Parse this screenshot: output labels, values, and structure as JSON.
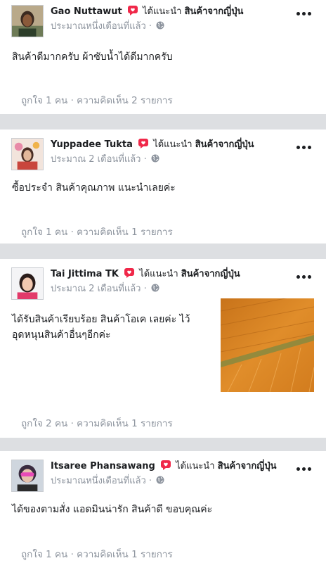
{
  "posts": [
    {
      "name": "Gao Nuttawut",
      "recommends": "ได้แนะนำ",
      "page": "สินค้าจากญี่ปุ่น",
      "time": "ประมาณหนึ่งเดือนที่แล้ว ·",
      "body": "สินค้าดีมากครับ ผ้าซับน้ำได้ดีมากครับ",
      "likes": "ถูกใจ 1 คน",
      "comments": "ความคิดเห็น 2 รายการ"
    },
    {
      "name": "Yuppadee Tukta",
      "recommends": "ได้แนะนำ",
      "page": "สินค้าจากญี่ปุ่น",
      "time": "ประมาณ 2 เดือนที่แล้ว ·",
      "body": "ซื้อประจำ สินค้าคุณภาพ แนะนำเลยค่ะ",
      "likes": "ถูกใจ 1 คน",
      "comments": "ความคิดเห็น 1 รายการ"
    },
    {
      "name": "Tai Jittima TK",
      "recommends": "ได้แนะนำ",
      "page": "สินค้าจากญี่ปุ่น",
      "time": "ประมาณ 2 เดือนที่แล้ว ·",
      "body_line1": "ได้รับสินค้าเรียบร้อย สินค้าโอเค เลยค่ะ ไว้",
      "body_line2": "อุดหนุนสินค้าอื่นๆอีกค่ะ",
      "likes": "ถูกใจ 2 คน",
      "comments": "ความคิดเห็น 1 รายการ"
    },
    {
      "name": "Itsaree Phansawang",
      "recommends": "ได้แนะนำ",
      "page": "สินค้าจากญี่ปุ่น",
      "time": "ประมาณหนึ่งเดือนที่แล้ว ·",
      "body": "ได้ของตามสั่ง แอดมินน่ารัก สินค้าดี ขอบคุณค่ะ",
      "likes": "ถูกใจ 1 คน",
      "comments": "ความคิดเห็น 1 รายการ"
    }
  ],
  "separator": " · ",
  "colors": {
    "recommend_icon": "#f02849",
    "meta_gray": "#8d949e",
    "divider": "#dddfe2"
  }
}
